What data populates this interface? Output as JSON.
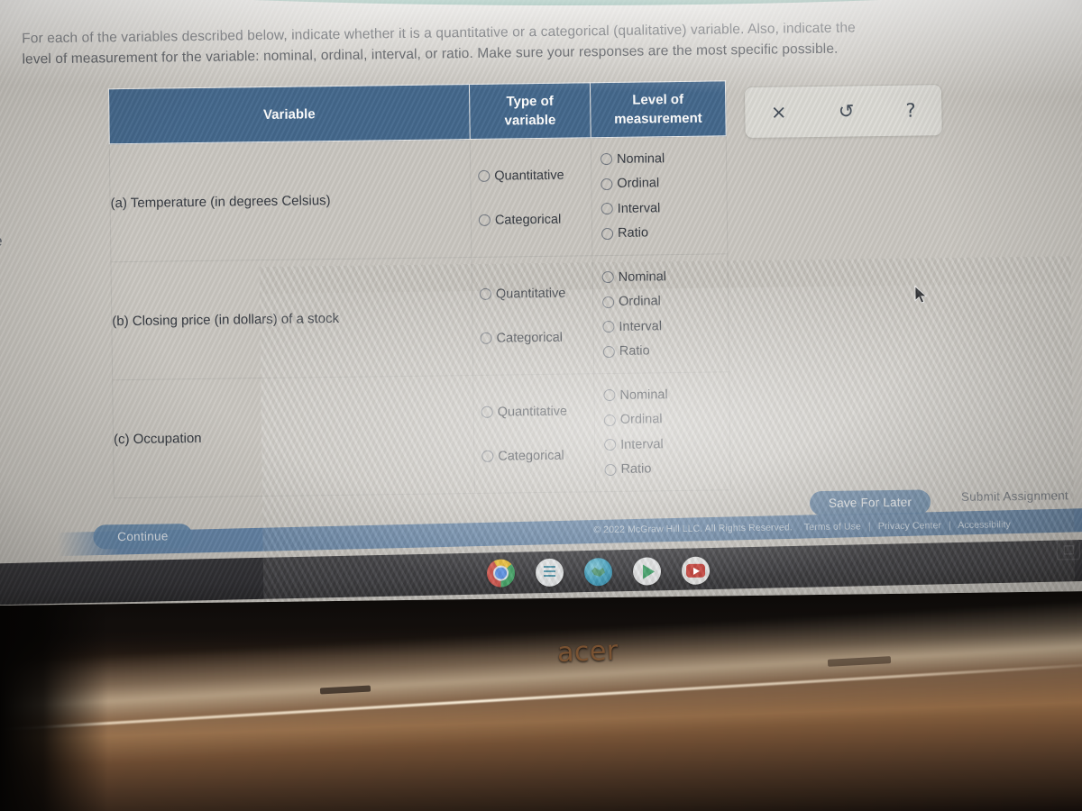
{
  "instructions": {
    "line1": "For each of the variables described below, indicate whether it is a quantitative or a categorical (qualitative) variable. Also, indicate the",
    "line2": "level of measurement for the variable: nominal, ordinal, interval, or ratio. Make sure your responses are the most specific possible."
  },
  "left_edge_fragment": "e",
  "table": {
    "headers": {
      "variable": "Variable",
      "type_of_variable": "Type of\nvariable",
      "type_line1": "Type of",
      "type_line2": "variable",
      "level_line1": "Level of",
      "level_line2": "measurement"
    },
    "type_options": [
      "Quantitative",
      "Categorical"
    ],
    "level_options": [
      "Nominal",
      "Ordinal",
      "Interval",
      "Ratio"
    ],
    "rows": [
      {
        "label": "(a) Temperature (in degrees Celsius)",
        "type_selected": null,
        "level_selected": null
      },
      {
        "label": "(b) Closing price (in dollars) of a stock",
        "type_selected": null,
        "level_selected": null
      },
      {
        "label": "(c) Occupation",
        "type_selected": null,
        "level_selected": null
      }
    ]
  },
  "toolbox": {
    "clear_label": "×",
    "undo_label": "↺",
    "help_label": "?"
  },
  "buttons": {
    "continue": "Continue",
    "save_for_later": "Save For Later",
    "submit_assignment": "Submit Assignment"
  },
  "footer": {
    "copyright": "© 2022 McGraw Hill LLC. All Rights Reserved.",
    "terms": "Terms of Use",
    "privacy": "Privacy Center",
    "accessibility": "Accessibility",
    "separator": "|"
  },
  "shelf": {
    "icons": [
      "chrome-icon",
      "docs-icon",
      "earth-icon",
      "play-store-icon",
      "youtube-icon"
    ],
    "status_icon": "display-settings-icon"
  },
  "device": {
    "brand": "acer"
  },
  "colors": {
    "header_blue": "#3d6288",
    "button_blue": "#5c81a6",
    "footer_blue": "#5f81a6",
    "top_strip_green": "#2f7a66",
    "screen_bg": "#c8c5bf",
    "text": "#2b3038"
  }
}
